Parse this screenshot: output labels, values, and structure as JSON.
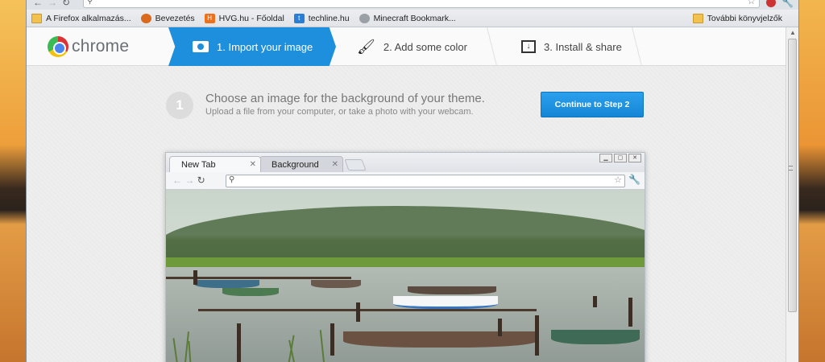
{
  "bookmarks": [
    {
      "icon": "folder-icon",
      "label": "A Firefox alkalmazás..."
    },
    {
      "icon": "firefox-icon",
      "label": "Bevezetés"
    },
    {
      "icon": "hvg-icon",
      "label": "HVG.hu - Főoldal"
    },
    {
      "icon": "techline-icon",
      "label": "techline.hu"
    },
    {
      "icon": "minecraft-icon",
      "label": "Minecraft Bookmark..."
    }
  ],
  "bookmarks_more": "További könyvjelzők",
  "logo_text": "chrome",
  "steps": [
    {
      "label": "1. Import your image",
      "active": true
    },
    {
      "label": "2. Add some color",
      "active": false
    },
    {
      "label": "3. Install & share",
      "active": false
    }
  ],
  "instruction": {
    "number": "1",
    "title": "Choose an image for the background of your theme.",
    "subtitle": "Upload a file from your computer, or take a photo with your webcam."
  },
  "continue_label": "Continue to Step 2",
  "preview": {
    "tabs": [
      {
        "label": "New Tab",
        "active": true
      },
      {
        "label": "Background Tab",
        "active": false
      }
    ]
  },
  "colors": {
    "accent": "#1e8fdc"
  }
}
